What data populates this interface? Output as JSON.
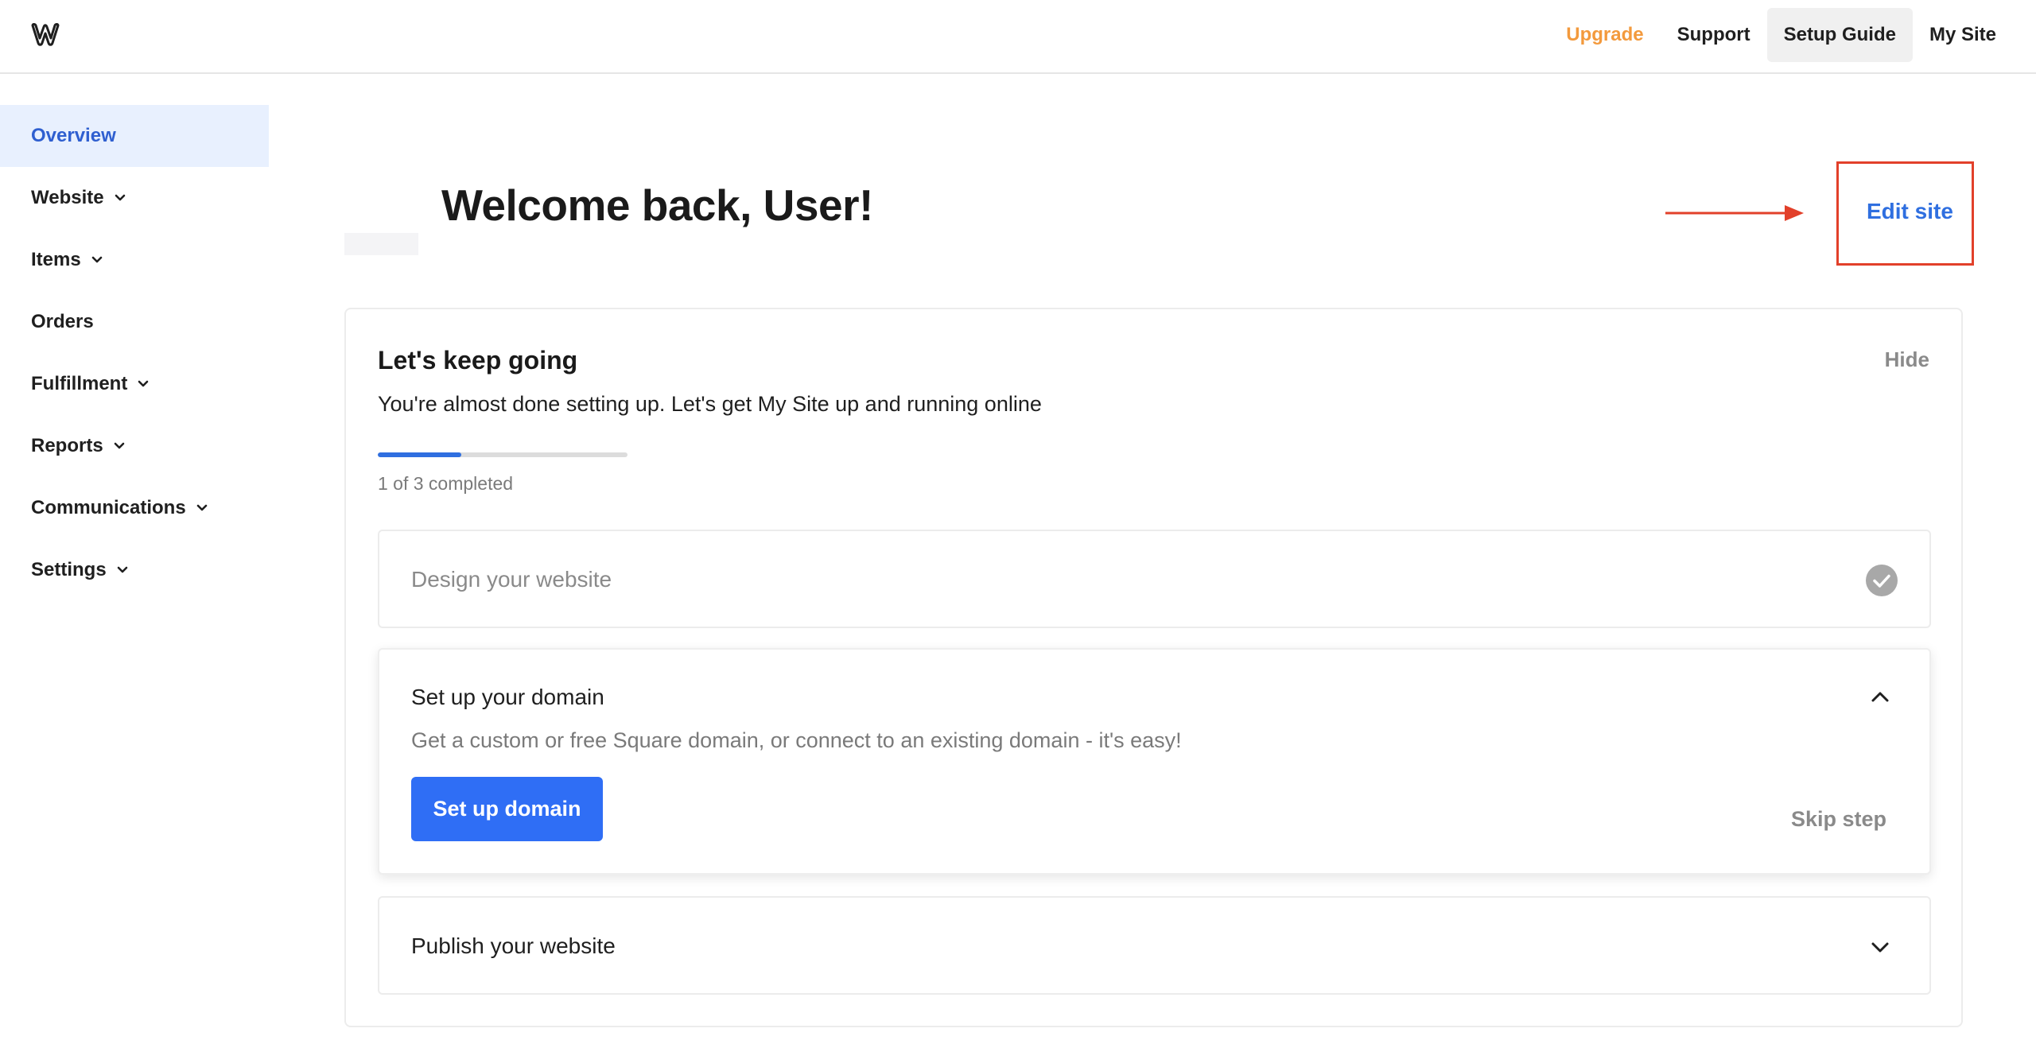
{
  "header": {
    "logo_icon": "weebly-w-logo-icon",
    "nav": {
      "upgrade": "Upgrade",
      "support": "Support",
      "setup_guide": "Setup Guide",
      "my_site": "My Site"
    },
    "upgrade_color": "#f39a3d"
  },
  "sidebar": {
    "items": [
      {
        "label": "Overview",
        "active": true,
        "expandable": false
      },
      {
        "label": "Website",
        "active": false,
        "expandable": true
      },
      {
        "label": "Items",
        "active": false,
        "expandable": true
      },
      {
        "label": "Orders",
        "active": false,
        "expandable": false
      },
      {
        "label": "Fulfillment",
        "active": false,
        "expandable": true
      },
      {
        "label": "Reports",
        "active": false,
        "expandable": true
      },
      {
        "label": "Communications",
        "active": false,
        "expandable": true
      },
      {
        "label": "Settings",
        "active": false,
        "expandable": true
      }
    ]
  },
  "main": {
    "welcome": "Welcome back, User!",
    "edit_site": "Edit site",
    "annotation_color": "#e2402a",
    "accent_color": "#2f6fe0"
  },
  "setup_card": {
    "title": "Let's keep going",
    "hide": "Hide",
    "subtitle": "You're almost done setting up. Let's get My Site up and running online",
    "progress_fraction": 0.333,
    "progress_text": "1 of 3 completed",
    "steps": {
      "design": {
        "title": "Design your website",
        "status": "completed"
      },
      "domain": {
        "title": "Set up your domain",
        "description": "Get a custom or free Square domain, or connect to an existing domain - it's easy!",
        "button": "Set up domain",
        "skip": "Skip step",
        "expanded": true
      },
      "publish": {
        "title": "Publish your website",
        "expanded": false
      }
    }
  }
}
